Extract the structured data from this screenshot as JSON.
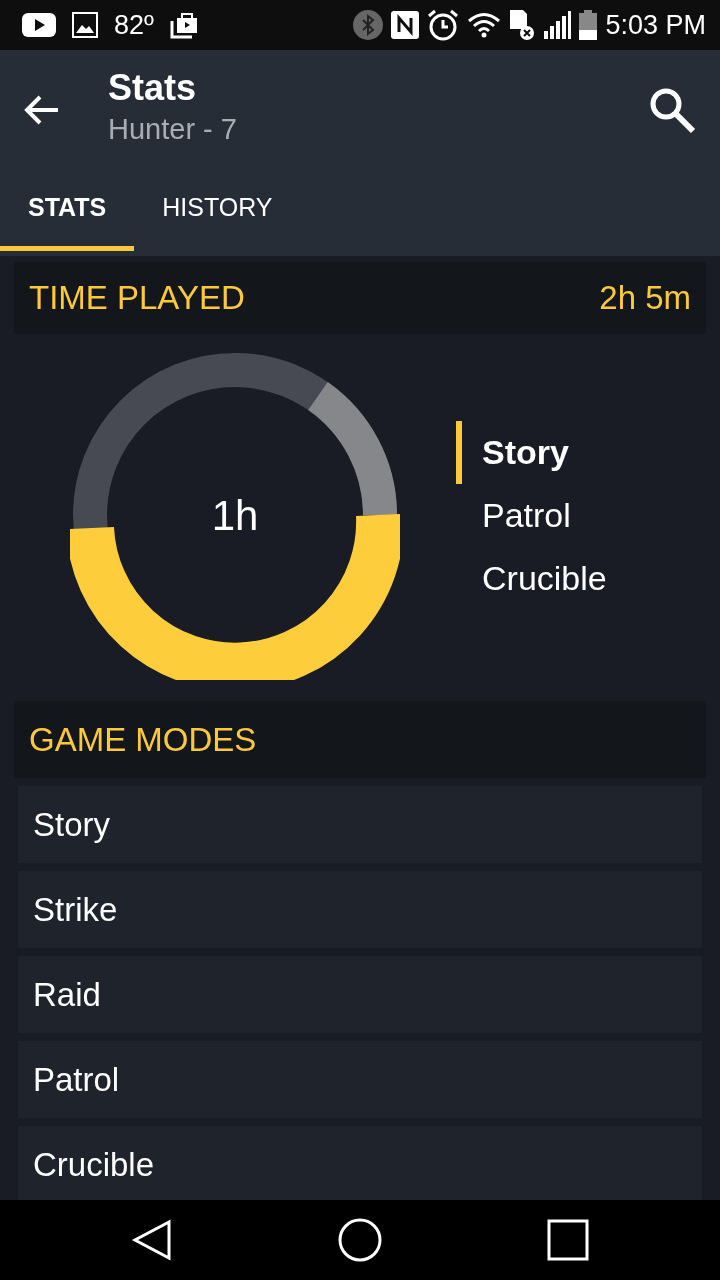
{
  "status_bar": {
    "temperature": "82º",
    "time": "5:03 PM"
  },
  "app_bar": {
    "title": "Stats",
    "subtitle": "Hunter - 7"
  },
  "tabs": [
    {
      "label": "STATS",
      "selected": true
    },
    {
      "label": "HISTORY",
      "selected": false
    }
  ],
  "time_played": {
    "heading": "TIME PLAYED",
    "total": "2h 5m",
    "center_label": "1h",
    "legend": [
      {
        "label": "Story",
        "selected": true
      },
      {
        "label": "Patrol",
        "selected": false
      },
      {
        "label": "Crucible",
        "selected": false
      }
    ]
  },
  "game_modes": {
    "heading": "GAME MODES",
    "items": [
      "Story",
      "Strike",
      "Raid",
      "Patrol",
      "Crucible"
    ]
  }
}
